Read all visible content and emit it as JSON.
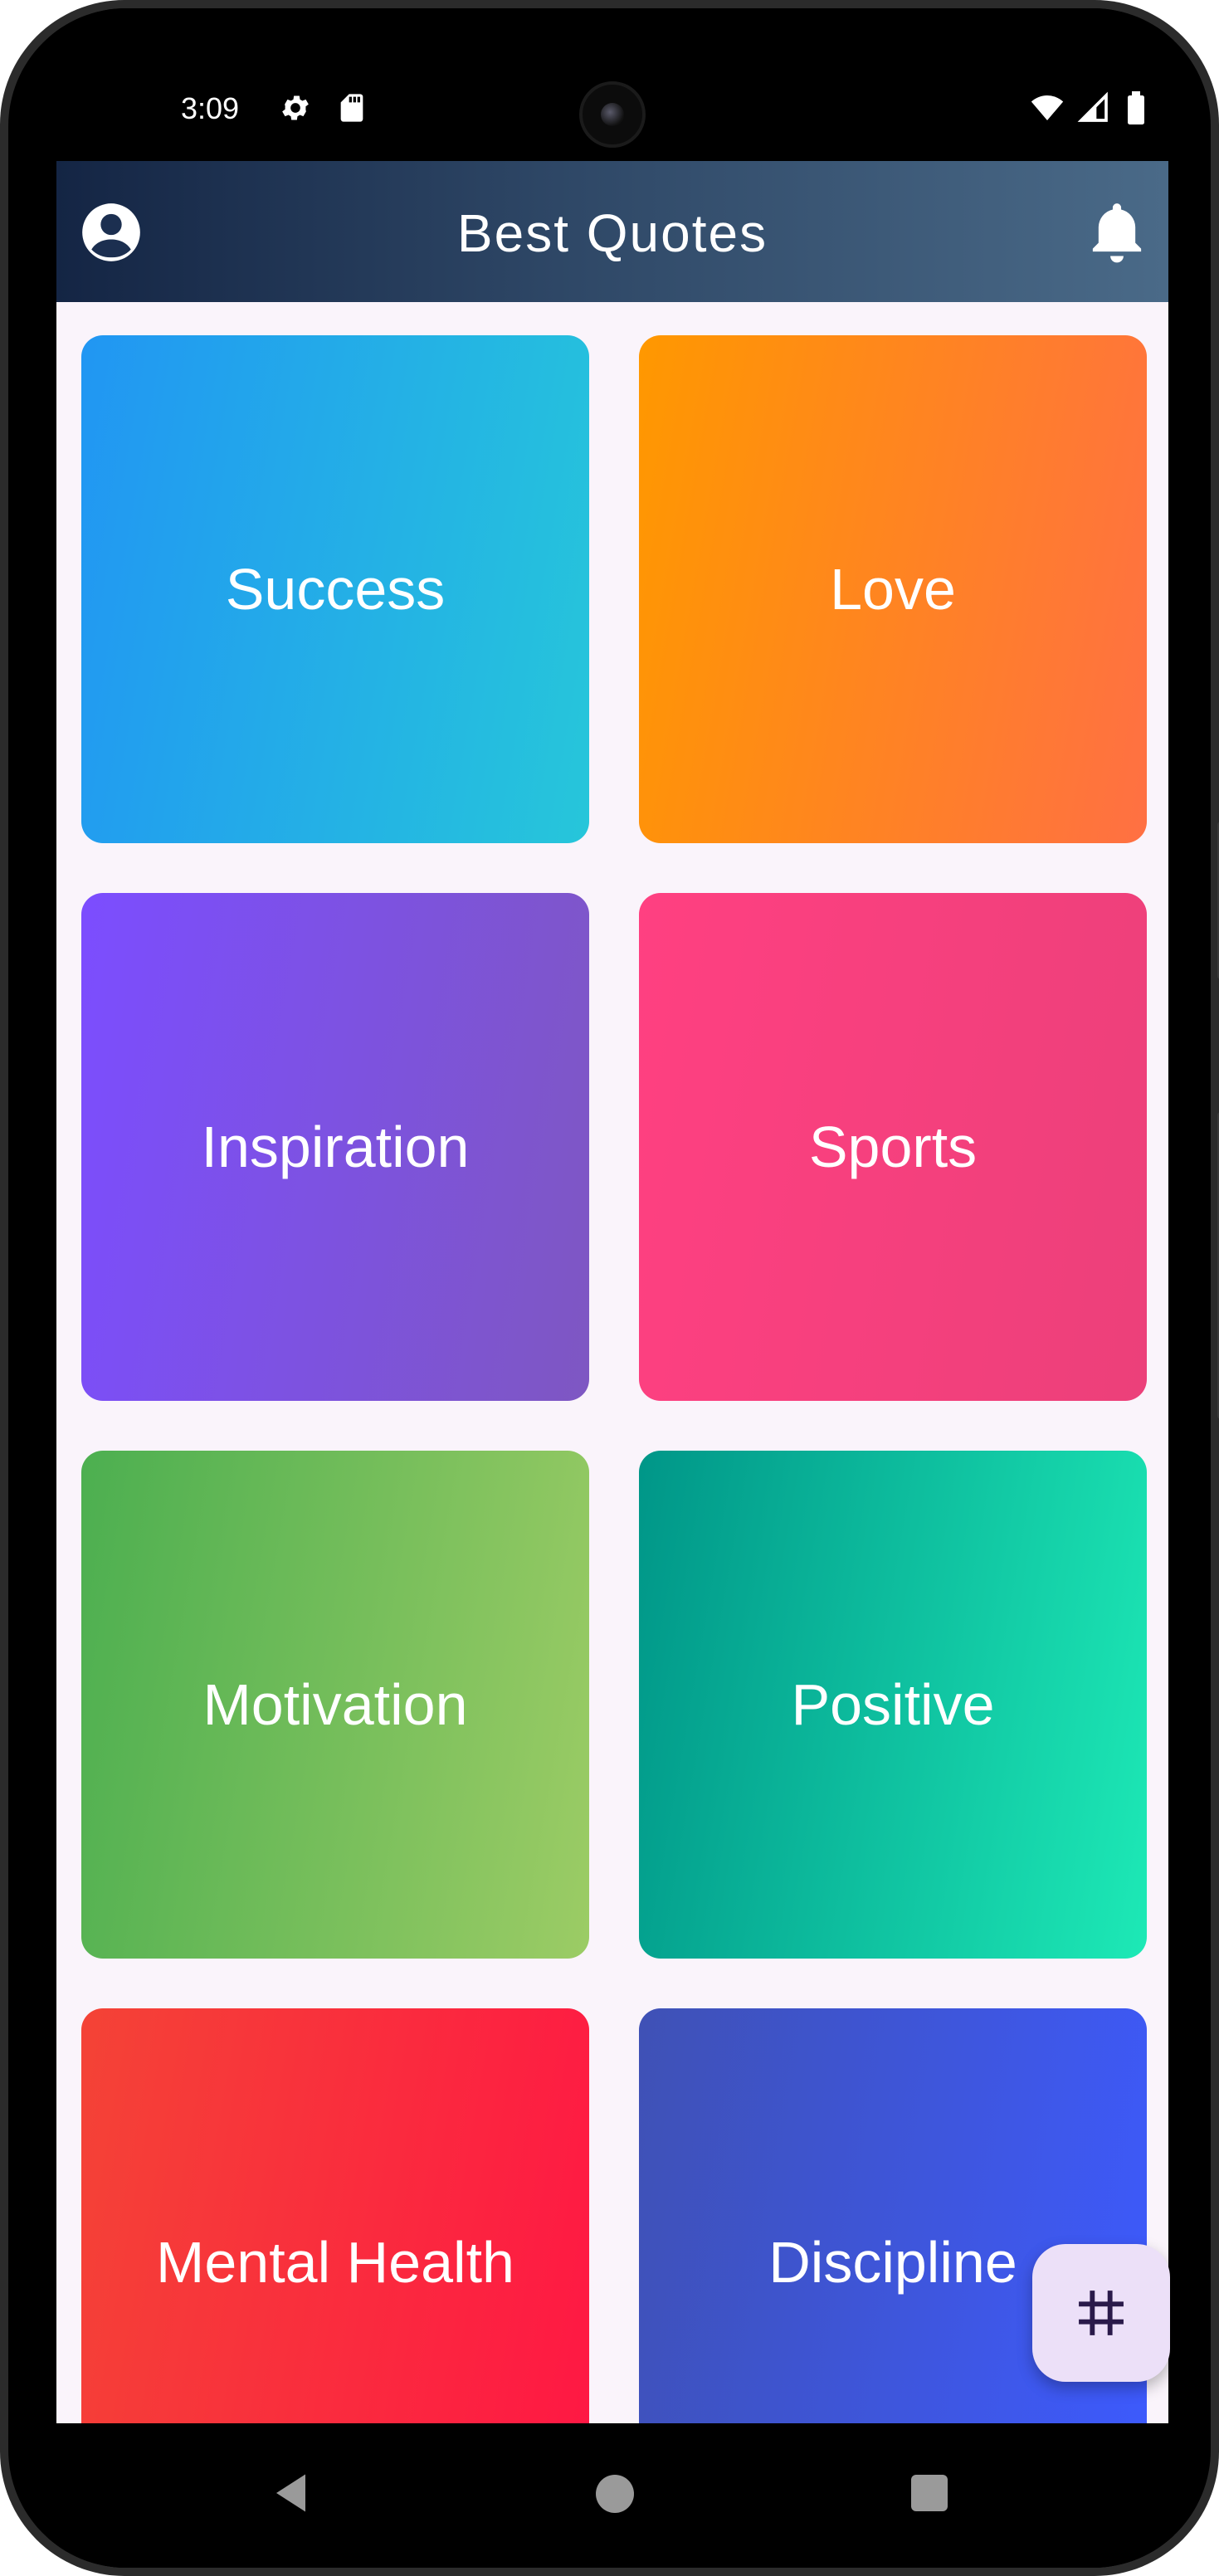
{
  "status_bar": {
    "time": "3:09",
    "icons": [
      "settings-icon",
      "sd-card-icon",
      "wifi-icon",
      "signal-icon",
      "battery-icon"
    ]
  },
  "app_bar": {
    "title": "Best Quotes",
    "left_icon": "account-circle-icon",
    "right_icon": "bell-icon"
  },
  "categories": [
    {
      "label": "Success",
      "colors": [
        "#2196F3",
        "#26C6DA"
      ]
    },
    {
      "label": "Love",
      "colors": [
        "#FF9800",
        "#FF7043"
      ]
    },
    {
      "label": "Inspiration",
      "colors": [
        "#7C4DFF",
        "#7E57C2"
      ]
    },
    {
      "label": "Sports",
      "colors": [
        "#FF4081",
        "#EC407A"
      ]
    },
    {
      "label": "Motivation",
      "colors": [
        "#4CAF50",
        "#9CCC65"
      ]
    },
    {
      "label": "Positive",
      "colors": [
        "#009688",
        "#1DE9B6"
      ]
    },
    {
      "label": "Mental Health",
      "colors": [
        "#F44336",
        "#FF1744"
      ]
    },
    {
      "label": "Discipline",
      "colors": [
        "#3F51B5",
        "#3D5AFE"
      ]
    }
  ],
  "fab": {
    "icon": "grid-icon",
    "bg": "#ECE0F8"
  },
  "nav_bar": {
    "icons": [
      "back-icon",
      "home-icon",
      "recents-icon"
    ]
  }
}
